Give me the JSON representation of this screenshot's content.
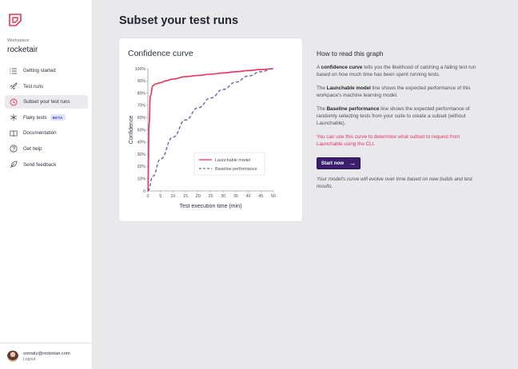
{
  "sidebar": {
    "workspace_label": "Workspace",
    "workspace_name": "rocketair",
    "items": [
      {
        "label": "Getting started",
        "icon": "list-icon",
        "active": false
      },
      {
        "label": "Test runs",
        "icon": "rocket-icon",
        "active": false
      },
      {
        "label": "Subset your test runs",
        "icon": "clock-icon",
        "active": true
      },
      {
        "label": "Flaky tests",
        "icon": "snowflake-icon",
        "active": false,
        "badge": "BETA"
      },
      {
        "label": "Documentation",
        "icon": "book-icon",
        "active": false
      },
      {
        "label": "Get help",
        "icon": "help-icon",
        "active": false
      },
      {
        "label": "Send feedback",
        "icon": "feather-icon",
        "active": false
      }
    ],
    "user": {
      "email": "somaly@rocketair.com",
      "logout": "Logout"
    }
  },
  "main": {
    "title": "Subset your test runs",
    "card_title": "Confidence curve"
  },
  "info": {
    "title": "How to read this graph",
    "p1_pre": "A ",
    "p1_bold": "confidence curve",
    "p1_post": " tells you the likelihood of catching a failing test run based on how much time has been spent running tests.",
    "p2_pre": "The ",
    "p2_bold": "Launchable model",
    "p2_post": " line shows the expected performance of this workpace's machine learning model.",
    "p3_pre": "The ",
    "p3_bold": "Baseline performance",
    "p3_post": " line shows the expected performance of randomly selecting tests from your suite to create a subset (without Launchable).",
    "highlight": "You can use this curve to determine what subset to request from Launchable using the CLI.",
    "button": "Start now",
    "note": "Your model's curve will evolve over time based on new builds and test results."
  },
  "colors": {
    "launchable": "#e8335a",
    "baseline": "#6f62a8",
    "button_bg": "#3b1f6e"
  },
  "chart_data": {
    "type": "line",
    "title": "Confidence curve",
    "xlabel": "Test execution time (min)",
    "ylabel": "Confidence",
    "xlim": [
      0,
      30
    ],
    "ylim": [
      0,
      100
    ],
    "xticks": [
      "0",
      "5",
      "10",
      "15",
      "20",
      "25",
      "30",
      "35",
      "40",
      "45",
      "50"
    ],
    "xtick_values": [
      0,
      5,
      10,
      15,
      20,
      25,
      30,
      35,
      40,
      45,
      50
    ],
    "x_axis_max": 50,
    "yticks": [
      "0",
      "10%",
      "20%",
      "30%",
      "40%",
      "50%",
      "60%",
      "70%",
      "80%",
      "90%",
      "100%"
    ],
    "ytick_values": [
      0,
      10,
      20,
      30,
      40,
      50,
      60,
      70,
      80,
      90,
      100
    ],
    "series": [
      {
        "name": "Launchable model",
        "style": "solid",
        "color": "#e8335a",
        "x": [
          0,
          0.5,
          1,
          2,
          3,
          5,
          7,
          10,
          15,
          20,
          25,
          30,
          35,
          40,
          45,
          50
        ],
        "y": [
          0,
          55,
          78,
          86,
          87.5,
          88.5,
          90,
          91.5,
          93.5,
          94.5,
          95.5,
          96.5,
          97.5,
          98.5,
          99.3,
          100
        ]
      },
      {
        "name": "Baseline performance",
        "style": "dashed",
        "color": "#6f62a8",
        "x": [
          0,
          2,
          5,
          10,
          15,
          20,
          25,
          30,
          35,
          40,
          45,
          50
        ],
        "y": [
          0,
          12,
          26,
          44,
          58,
          68,
          76,
          83,
          89,
          94,
          97.5,
          100
        ]
      }
    ],
    "legend": "inside-bottom-right",
    "grid": false
  }
}
